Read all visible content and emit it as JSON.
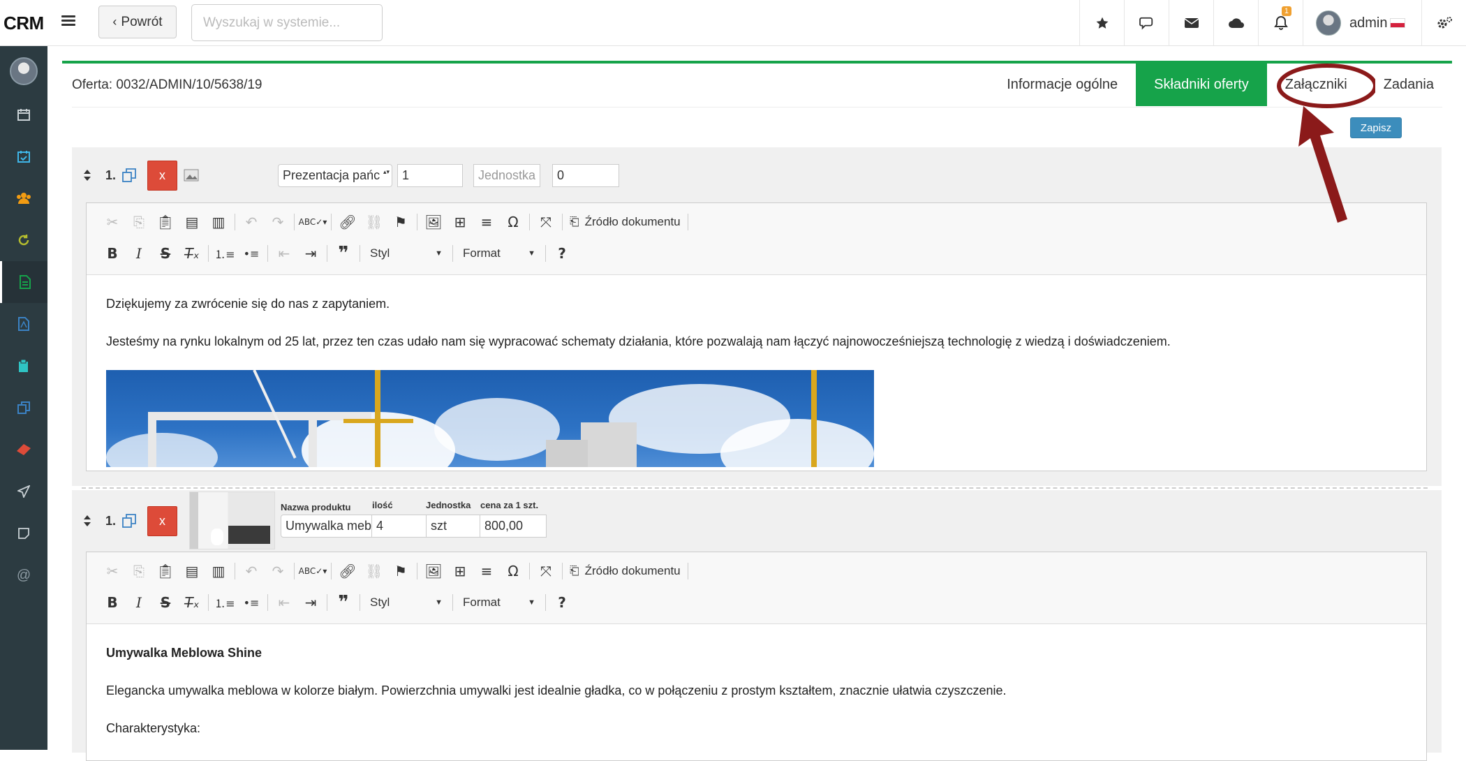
{
  "app": {
    "logo": "CRM"
  },
  "topbar": {
    "back_label": "Powrót",
    "search_placeholder": "Wyszukaj w systemie...",
    "notifications_count": "1",
    "user_name": "admin"
  },
  "offer": {
    "title": "Oferta: 0032/ADMIN/10/5638/19",
    "tabs": [
      {
        "label": "Informacje ogólne",
        "active": false
      },
      {
        "label": "Składniki oferty",
        "active": true
      },
      {
        "label": "Załączniki",
        "active": false
      },
      {
        "label": "Zadania",
        "active": false
      }
    ],
    "save_label": "Zapisz"
  },
  "items": [
    {
      "number": "1.",
      "delete_label": "x",
      "type_select": "Prezentacja pańc",
      "qty": "1",
      "unit_placeholder": "Jednostka",
      "price": "0",
      "paragraphs": [
        "Dziękujemy za zwrócenie się do nas z zapytaniem.",
        "Jesteśmy na rynku lokalnym od 25 lat, przez ten czas udało nam się wypracować schematy działania, które pozwalają nam łączyć najnowocześniejszą technologię z wiedzą i doświadczeniem."
      ]
    },
    {
      "number": "1.",
      "delete_label": "x",
      "labels": {
        "name": "Nazwa produktu",
        "qty": "ilość",
        "unit": "Jednostka",
        "price": "cena za 1 szt."
      },
      "product_select": "Umywalka meblow",
      "qty": "4",
      "unit": "szt",
      "price": "800,00",
      "heading": "Umywalka Meblowa Shine",
      "paragraphs": [
        "Elegancka umywalka meblowa w kolorze białym. Powierzchnia umywalki jest idealnie gładka, co w połączeniu z prostym kształtem, znacznie ułatwia czyszczenie.",
        "Charakterystyka:"
      ]
    }
  ],
  "editor_toolbar": {
    "source_label": "Źródło dokumentu",
    "style_label": "Styl",
    "format_label": "Format",
    "help_label": "?"
  },
  "colors": {
    "sidebar": "#2c3b41",
    "active_tab": "#16a34a",
    "save": "#3c8dbc",
    "delete": "#dd4b39",
    "annotation": "#8b1a1a"
  }
}
